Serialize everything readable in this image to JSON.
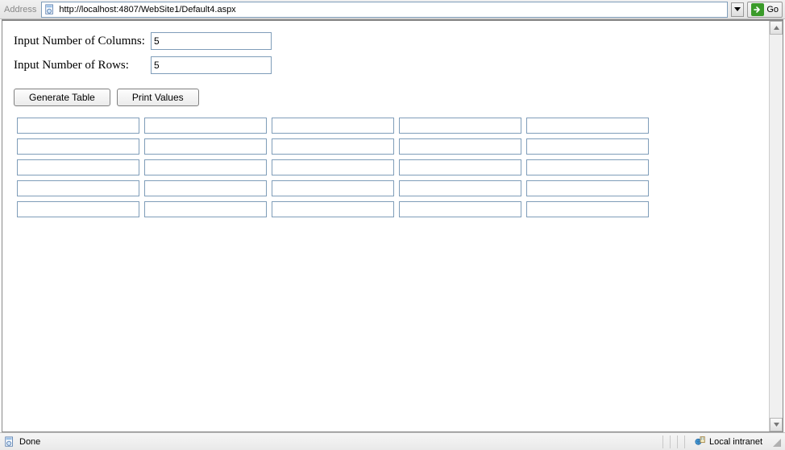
{
  "addressBar": {
    "label": "Address",
    "url": "http://localhost:4807/WebSite1/Default4.aspx",
    "goLabel": "Go"
  },
  "form": {
    "columnsLabel": "Input Number of Columns:",
    "columnsValue": "5",
    "rowsLabel": "Input Number of Rows:",
    "rowsValue": "5",
    "generateLabel": "Generate Table",
    "printLabel": "Print Values"
  },
  "table": {
    "rows": 5,
    "cols": 5,
    "cells": [
      [
        "",
        "",
        "",
        "",
        ""
      ],
      [
        "",
        "",
        "",
        "",
        ""
      ],
      [
        "",
        "",
        "",
        "",
        ""
      ],
      [
        "",
        "",
        "",
        "",
        ""
      ],
      [
        "",
        "",
        "",
        "",
        ""
      ]
    ]
  },
  "statusBar": {
    "status": "Done",
    "zone": "Local intranet"
  }
}
